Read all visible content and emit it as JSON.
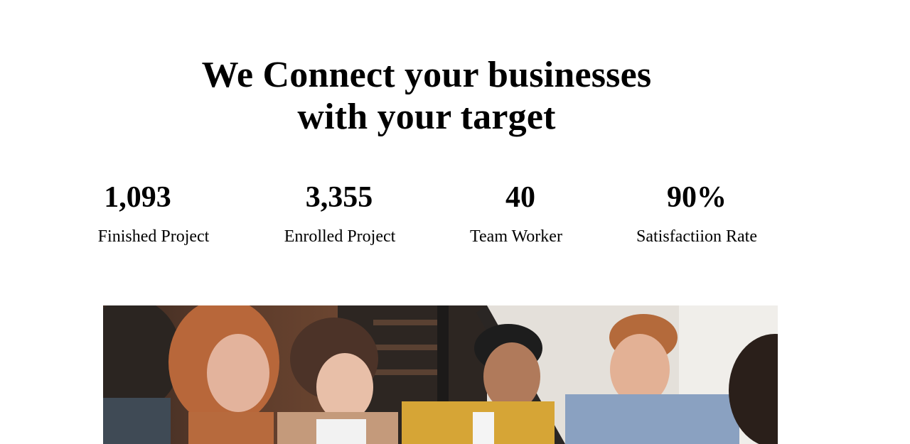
{
  "hero": {
    "title_line1": "We Connect your businesses",
    "title_line2": "with your target"
  },
  "stats": [
    {
      "value": "1,093",
      "label": "Finished Project"
    },
    {
      "value": "3,355",
      "label": "Enrolled Project"
    },
    {
      "value": "40",
      "label": "Team Worker"
    },
    {
      "value": "90%",
      "label": "Satisfactiion Rate"
    }
  ],
  "colors": {
    "background": "#ffffff",
    "text": "#000000"
  }
}
